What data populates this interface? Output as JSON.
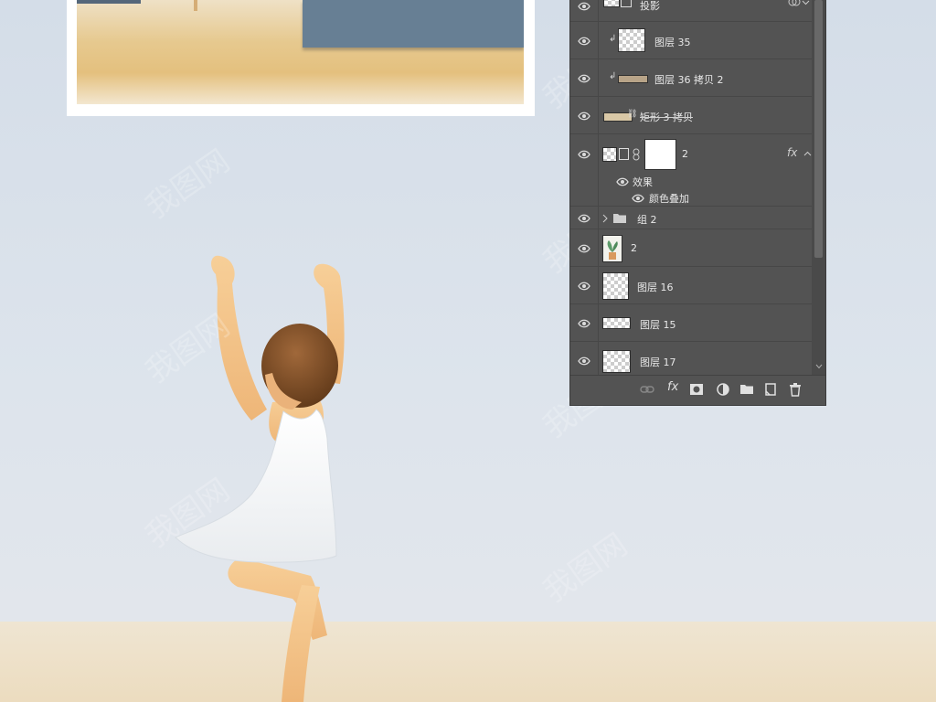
{
  "layers_panel": {
    "layers": [
      {
        "name": "投影",
        "kind": "effect-layer",
        "visible": true,
        "has_fx_icon": false,
        "linked_icon": true
      },
      {
        "name": "图层 35",
        "kind": "pixel",
        "clipped": true,
        "visible": true
      },
      {
        "name": "图层 36 拷贝 2",
        "kind": "pixel",
        "clipped": true,
        "visible": true
      },
      {
        "name": "矩形 3 拷贝",
        "kind": "shape",
        "visible": true
      },
      {
        "name": "2",
        "kind": "smart-object-with-mask",
        "visible": true,
        "fx_label": "fx",
        "effects_label": "效果",
        "effects": [
          {
            "name": "颜色叠加",
            "visible": true
          }
        ]
      },
      {
        "name": "组 2",
        "kind": "group",
        "visible": true,
        "collapsed": true
      },
      {
        "name": "2",
        "kind": "image",
        "visible": true
      },
      {
        "name": "图层 16",
        "kind": "pixel",
        "visible": true
      },
      {
        "name": "图层 15",
        "kind": "pixel",
        "visible": true
      },
      {
        "name": "图层 17",
        "kind": "pixel",
        "visible": true
      }
    ],
    "footer_icons": [
      "link-icon",
      "fx-icon",
      "mask-icon",
      "adjustment-icon",
      "folder-icon",
      "new-layer-icon",
      "trash-icon"
    ],
    "footer_fx_label": "fx"
  },
  "canvas": {
    "watermark_text": "我图网",
    "colors": {
      "sky": "#d8e0ea",
      "floor": "#ecdcbf",
      "panel": "#535353",
      "wall": "#677f94"
    }
  }
}
